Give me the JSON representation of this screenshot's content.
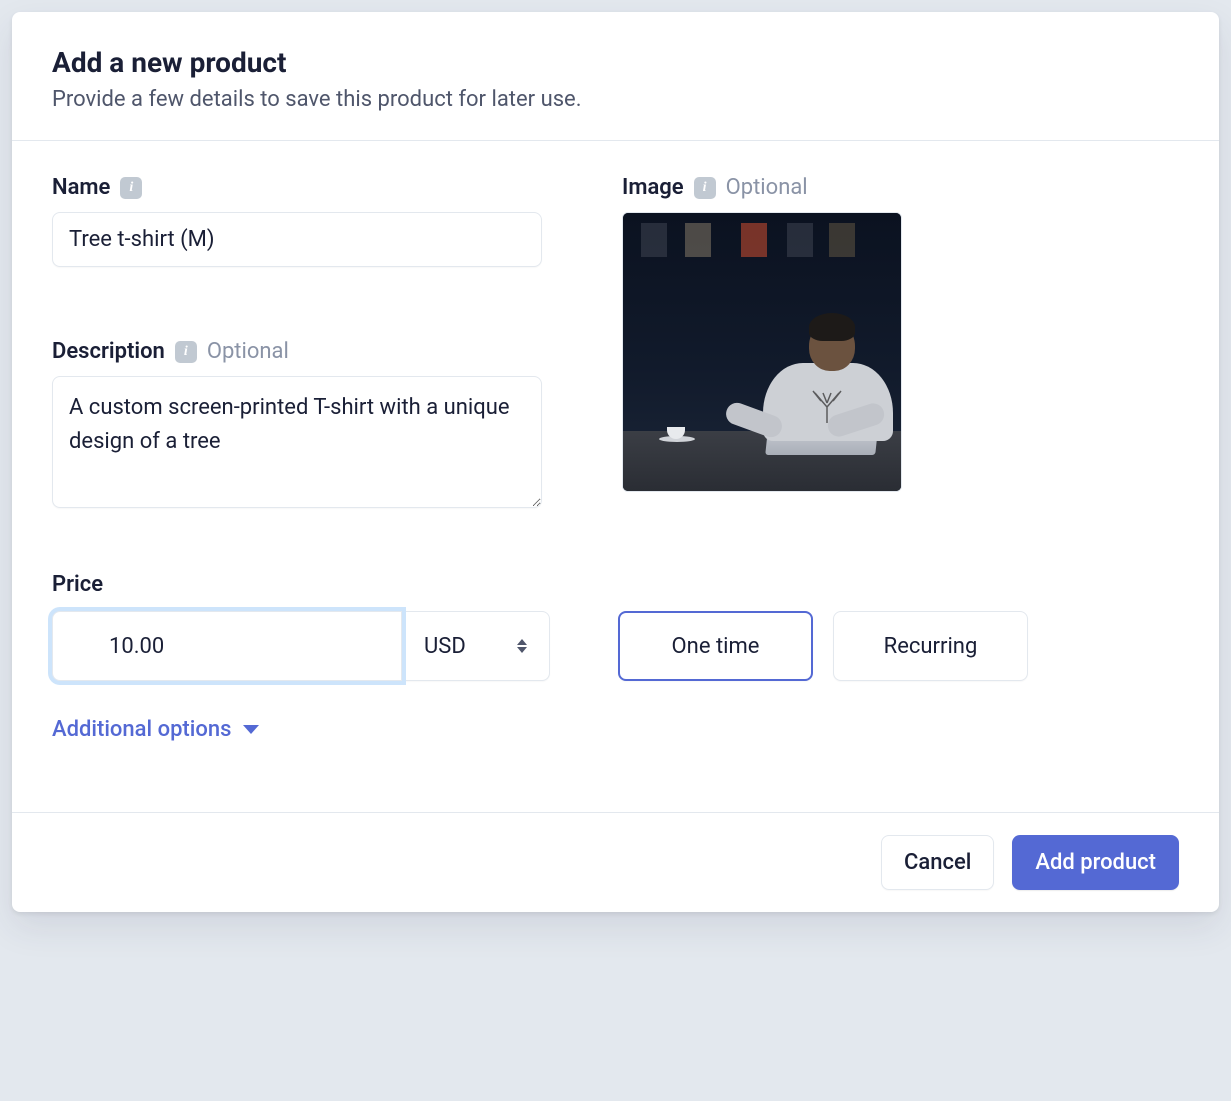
{
  "header": {
    "title": "Add a new product",
    "subtitle": "Provide a few details to save this product for later use."
  },
  "fields": {
    "name": {
      "label": "Name",
      "value": "Tree t-shirt (M)"
    },
    "description": {
      "label": "Description",
      "optional": "Optional",
      "value": "A custom screen-printed T-shirt with a unique design of a tree"
    },
    "image": {
      "label": "Image",
      "optional": "Optional"
    },
    "price": {
      "label": "Price",
      "symbol": "$",
      "value": "10.00",
      "currency": "USD",
      "billing_one_time": "One time",
      "billing_recurring": "Recurring"
    }
  },
  "additional_options_label": "Additional options",
  "footer": {
    "cancel": "Cancel",
    "submit": "Add product"
  }
}
